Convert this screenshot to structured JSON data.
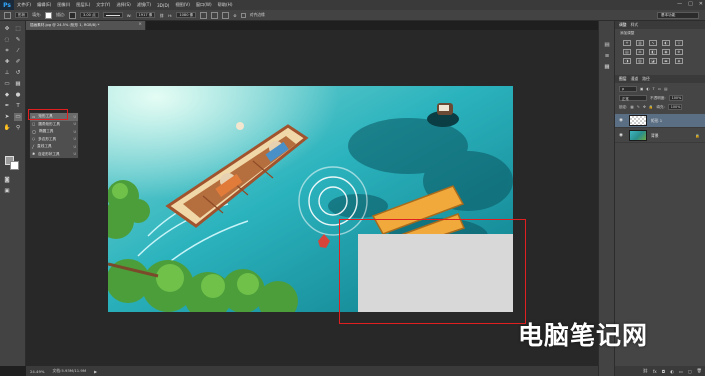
{
  "app": {
    "logo": "Ps",
    "menus": [
      "文件(F)",
      "编辑(E)",
      "图像(I)",
      "图层(L)",
      "文字(Y)",
      "选择(S)",
      "滤镜(T)",
      "3D(D)",
      "视图(V)",
      "窗口(W)",
      "帮助(H)"
    ],
    "window_controls": [
      "—",
      "□",
      "✕"
    ]
  },
  "options_bar": {
    "mode": "形状",
    "fill_label": "填充:",
    "stroke_label": "描边:",
    "stroke_width": "3.00 点",
    "w_label": "W:",
    "w_value": "1917 像",
    "h_label": "H:",
    "h_value": "1080 像",
    "align_edges": "对齐边缘",
    "workspace": "基本功能"
  },
  "document": {
    "tab_title": "插画素材.jpg @ 24.5% (矩形 1, RGB/8) *",
    "close_icon": "×"
  },
  "tool_flyout": {
    "items": [
      {
        "icon": "rectangle-tool-icon",
        "label": "矩形工具",
        "key": "U",
        "selected": true
      },
      {
        "icon": "rounded-rectangle-tool-icon",
        "label": "圆角矩形工具",
        "key": "U",
        "selected": false
      },
      {
        "icon": "ellipse-tool-icon",
        "label": "椭圆工具",
        "key": "U",
        "selected": false
      },
      {
        "icon": "polygon-tool-icon",
        "label": "多边形工具",
        "key": "U",
        "selected": false
      },
      {
        "icon": "line-tool-icon",
        "label": "直线工具",
        "key": "U",
        "selected": false
      },
      {
        "icon": "custom-shape-tool-icon",
        "label": "自定形状工具",
        "key": "U",
        "selected": false
      }
    ]
  },
  "status_bar": {
    "zoom": "24.49%",
    "doc_info": "文档:5.93M/11.9M"
  },
  "right_panel": {
    "tabs": [
      "调整",
      "样式"
    ],
    "adjustments_title": "添加调整",
    "layers_tabs": [
      "图层",
      "通道",
      "路径"
    ],
    "blend_mode": "正常",
    "opacity_label": "不透明度:",
    "opacity_value": "100%",
    "lock_label": "锁定:",
    "fill_label": "填充:",
    "fill_value": "100%",
    "layers": [
      {
        "name": "矩形 1",
        "thumb": "checker",
        "selected": true
      },
      {
        "name": "背景",
        "thumb": "art",
        "selected": false
      }
    ],
    "footer_icons": [
      "link-icon",
      "fx-icon",
      "mask-icon",
      "adjustment-icon",
      "folder-icon",
      "new-layer-icon",
      "trash-icon"
    ]
  },
  "watermark": "电脑笔记网",
  "colors": {
    "highlight": "#e02020",
    "placeholder_rect": "#d8d8d8",
    "panel_bg": "#454545",
    "workspace_bg": "#282828"
  }
}
